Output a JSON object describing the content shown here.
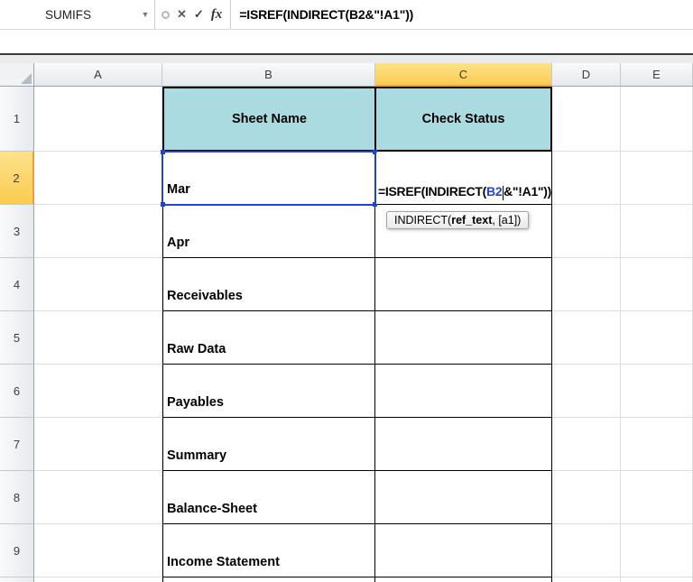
{
  "formula_bar": {
    "name_box_value": "SUMIFS",
    "dropdown_glyph": "▼",
    "cancel_label": "✕",
    "enter_label": "✓",
    "insert_function_label": "fx",
    "formula": "=ISREF(INDIRECT(B2&\"!A1\"))"
  },
  "sheet": {
    "column_headers": [
      "A",
      "B",
      "C",
      "D",
      "E"
    ],
    "row_headers": [
      "1",
      "2",
      "3",
      "4",
      "5",
      "6",
      "7",
      "8",
      "9"
    ],
    "table": {
      "header_sheet_name": "Sheet Name",
      "header_check_status": "Check Status"
    },
    "sheet_names": [
      "Mar",
      "Apr",
      "Receivables",
      "Raw Data",
      "Payables",
      "Summary",
      "Balance-Sheet",
      "Income Statement"
    ],
    "cell_edit": {
      "prefix": "=ISREF(INDIRECT(",
      "reference": "B2",
      "suffix": "&\"!A1\"))"
    },
    "tooltip": {
      "prefix": "INDIRECT(",
      "current_arg": "ref_text",
      "suffix": ", [a1])"
    }
  },
  "colors": {
    "table_header_fill": "#A9DBE0",
    "selected_header_fill": "#FACB51",
    "reference_blue": "#2244CC",
    "grid_line": "#D9DFE6"
  }
}
